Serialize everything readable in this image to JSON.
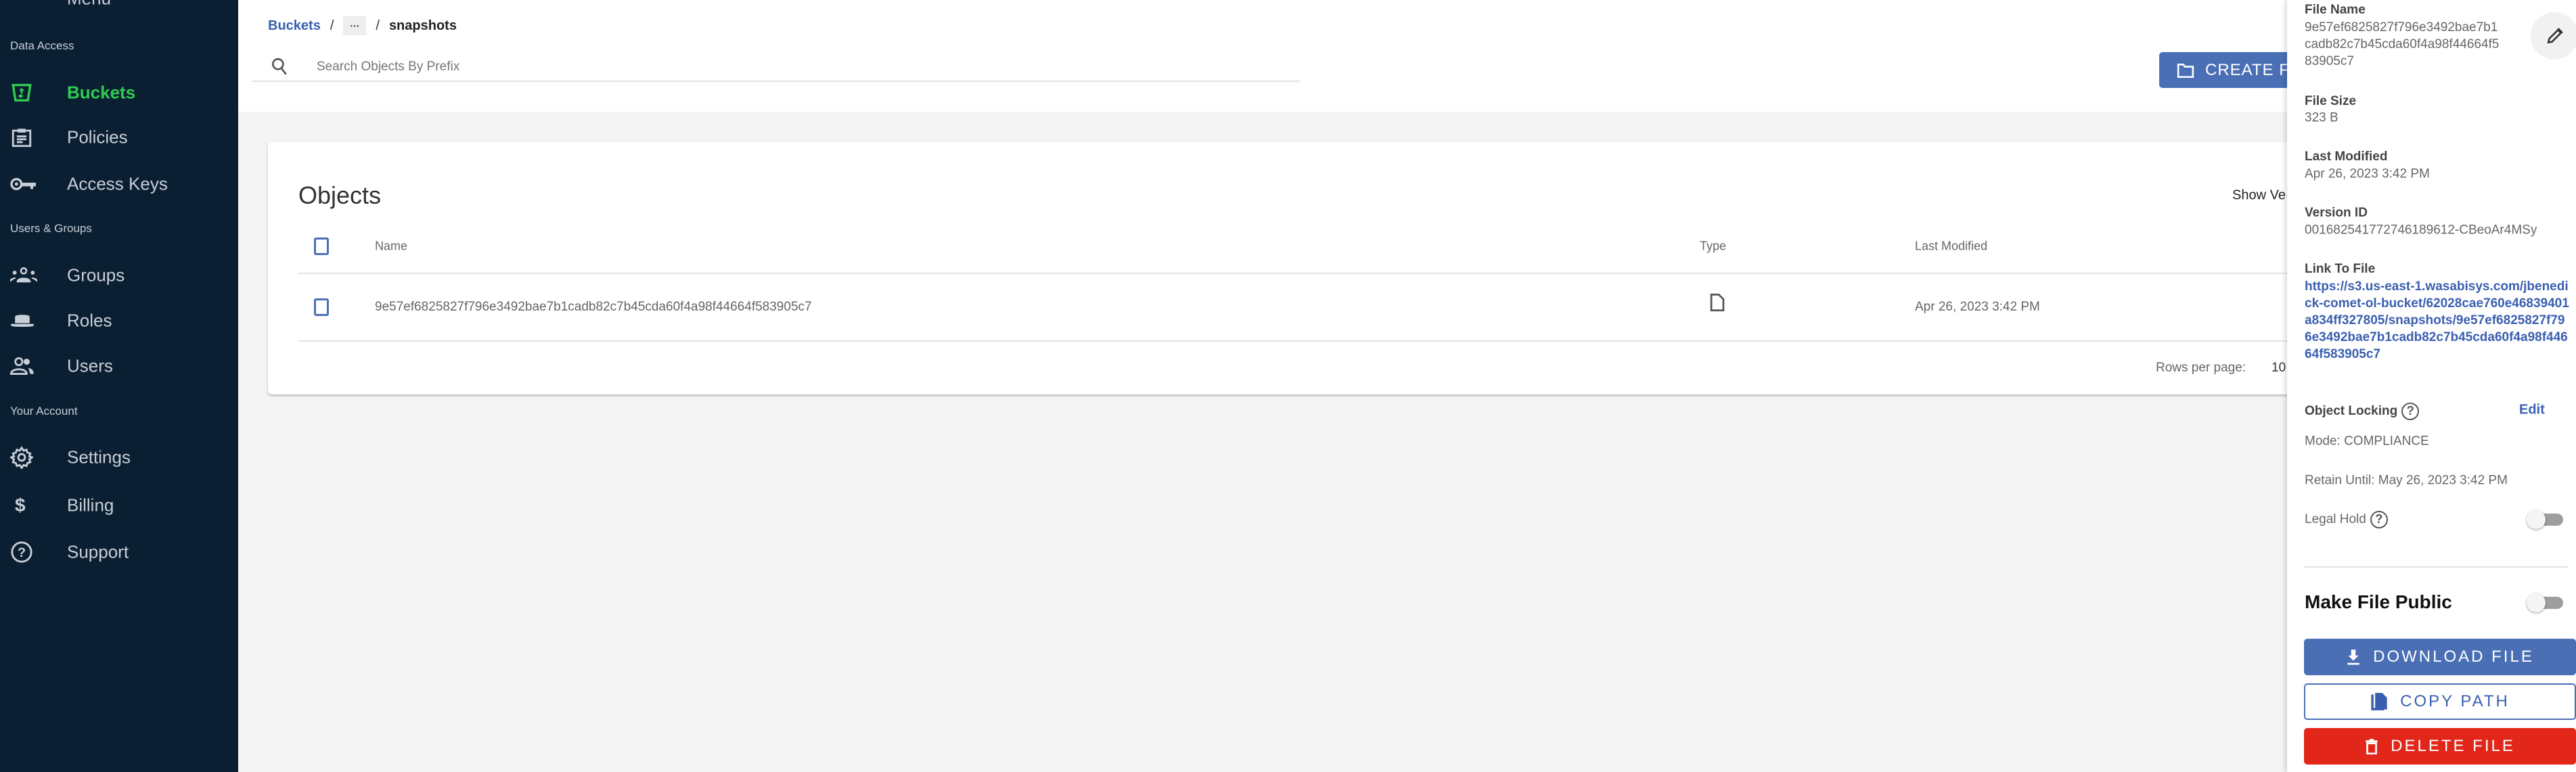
{
  "sidebar": {
    "menu_label": "Menu",
    "sections": [
      {
        "label": "Data Access",
        "items": [
          {
            "label": "Buckets",
            "icon": "bucket-icon",
            "active": true
          },
          {
            "label": "Policies",
            "icon": "clipboard-icon"
          },
          {
            "label": "Access Keys",
            "icon": "key-icon"
          }
        ]
      },
      {
        "label": "Users & Groups",
        "items": [
          {
            "label": "Groups",
            "icon": "groups-icon"
          },
          {
            "label": "Roles",
            "icon": "hat-icon"
          },
          {
            "label": "Users",
            "icon": "users-icon"
          }
        ]
      },
      {
        "label": "Your Account",
        "items": [
          {
            "label": "Settings",
            "icon": "gear-icon"
          },
          {
            "label": "Billing",
            "icon": "dollar-icon"
          },
          {
            "label": "Support",
            "icon": "help-circle-icon"
          }
        ]
      }
    ]
  },
  "breadcrumb": {
    "root": "Buckets",
    "sep": "/",
    "ellipsis": "···",
    "current": "snapshots"
  },
  "search": {
    "placeholder": "Search Objects By Prefix",
    "value": ""
  },
  "toolbar": {
    "create_folder_label": "CREATE F"
  },
  "objects": {
    "title": "Objects",
    "show_versions_label": "Show Ve",
    "columns": [
      "Name",
      "Type",
      "Last Modified"
    ],
    "rows": [
      {
        "name": "9e57ef6825827f796e3492bae7b1cadb82c7b45cda60f4a98f44664f583905c7",
        "type": "file-icon",
        "last_modified": "Apr 26, 2023 3:42 PM"
      }
    ],
    "rows_per_page_label": "Rows per page:",
    "rows_per_page_value": "10"
  },
  "details": {
    "file_name_label": "File Name",
    "file_name": "9e57ef6825827f796e3492bae7b1cadb82c7b45cda60f4a98f44664f583905c7",
    "file_size_label": "File Size",
    "file_size": "323 B",
    "last_modified_label": "Last Modified",
    "last_modified": "Apr 26, 2023 3:42 PM",
    "version_id_label": "Version ID",
    "version_id": "001682541772746189612-CBeoAr4MSy",
    "link_label": "Link To File",
    "link": "https://s3.us-east-1.wasabisys.com/jbenedick-comet-ol-bucket/62028cae760e46839401a834ff327805/snapshots/9e57ef6825827f796e3492bae7b1cadb82c7b45cda60f4a98f44664f583905c7",
    "object_locking_label": "Object Locking",
    "edit_label": "Edit",
    "mode": "Mode: COMPLIANCE",
    "retain_until": "Retain Until: May 26, 2023 3:42 PM",
    "legal_hold_label": "Legal Hold",
    "legal_hold_on": false,
    "make_public_label": "Make File Public",
    "make_public_on": false,
    "download_label": "DOWNLOAD FILE",
    "copy_path_label": "COPY PATH",
    "delete_label": "DELETE FILE"
  },
  "colors": {
    "sidebar_bg": "#0b1f33",
    "active_green": "#2ecc4f",
    "primary_blue": "#4a6fb5",
    "danger_red": "#e2261a"
  }
}
